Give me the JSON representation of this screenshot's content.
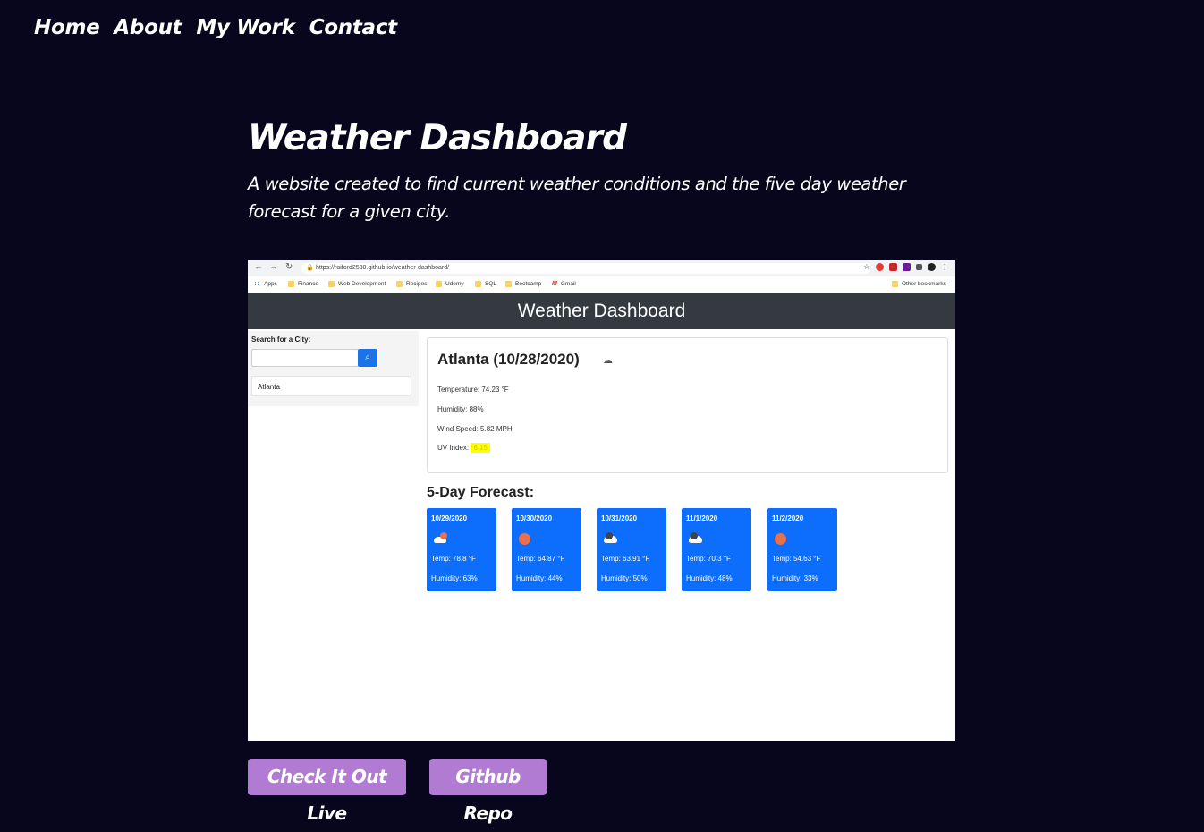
{
  "nav": {
    "items": [
      "Home",
      "About",
      "My Work",
      "Contact"
    ]
  },
  "project": {
    "title": "Weather Dashboard",
    "description": "A website created to find current weather conditions and the five day weather forecast for a given city."
  },
  "screenshot": {
    "url": "https://raiford2530.github.io/weather-dashboard/",
    "bookmarks": [
      "Apps",
      "Finance",
      "Web Development",
      "Recipes",
      "Udemy",
      "SQL",
      "Bootcamp",
      "Gmail",
      "Other bookmarks"
    ],
    "app_title": "Weather Dashboard",
    "search_label": "Search for a City:",
    "search_history": [
      "Atlanta"
    ],
    "current": {
      "city_date": "Atlanta (10/28/2020)",
      "temperature": "Temperature: 74.23 °F",
      "humidity": "Humidity: 88%",
      "wind": "Wind Speed: 5.82 MPH",
      "uv_label": "UV Index:",
      "uv_value": "6.15"
    },
    "forecast_title": "5-Day Forecast:",
    "forecast": [
      {
        "date": "10/29/2020",
        "icon": "partly-cloudy-icon",
        "temp": "Temp: 78.8 °F",
        "humidity": "Humidity: 63%"
      },
      {
        "date": "10/30/2020",
        "icon": "sun-icon",
        "temp": "Temp: 64.87 °F",
        "humidity": "Humidity: 44%"
      },
      {
        "date": "10/31/2020",
        "icon": "cloud-icon",
        "temp": "Temp: 63.91 °F",
        "humidity": "Humidity: 50%"
      },
      {
        "date": "11/1/2020",
        "icon": "cloud-icon",
        "temp": "Temp: 70.3 °F",
        "humidity": "Humidity: 48%"
      },
      {
        "date": "11/2/2020",
        "icon": "sun-icon",
        "temp": "Temp: 54.63 °F",
        "humidity": "Humidity: 33%"
      }
    ]
  },
  "buttons": {
    "live": "Check It Out Live",
    "repo": "Github Repo"
  },
  "colors": {
    "background": "#08061c",
    "button": "#b17bd3",
    "card": "#0d6efd",
    "app_header": "#343a40"
  }
}
